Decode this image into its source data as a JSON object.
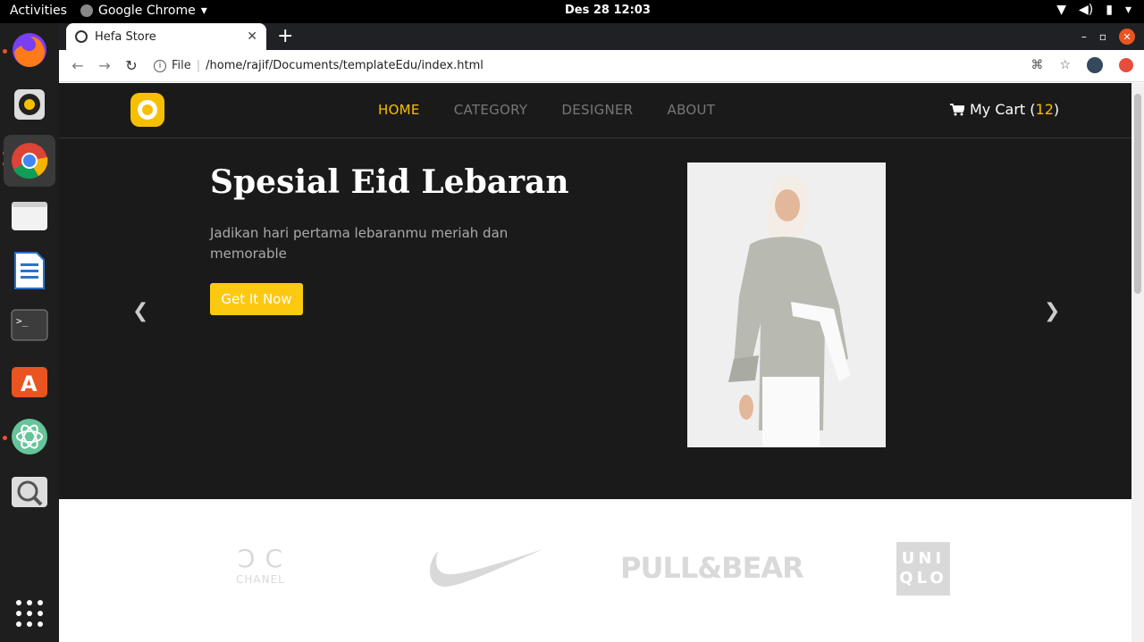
{
  "topbar": {
    "activities": "Activities",
    "app_name": "Google Chrome",
    "clock": "Des 28  12:03"
  },
  "dock": {
    "items": [
      "firefox-icon",
      "rhythmbox-icon",
      "chrome-icon",
      "files-icon",
      "writer-icon",
      "terminal-icon",
      "software-icon",
      "atom-icon",
      "screenshot-icon"
    ]
  },
  "browser": {
    "tab_title": "Hefa Store",
    "url_label": "File",
    "url": "/home/rajif/Documents/templateEdu/index.html"
  },
  "site": {
    "menu": [
      "HOME",
      "CATEGORY",
      "DESIGNER",
      "ABOUT"
    ],
    "cart_label": "My Cart (",
    "cart_count": "12",
    "cart_close": ")",
    "hero": {
      "title": "Spesial Eid Lebaran",
      "subtitle": "Jadikan hari pertama lebaranmu meriah dan memorable",
      "cta": "Get It Now"
    },
    "brands": {
      "chanel": "CHANEL",
      "pull": "PULL&BEAR",
      "uniqlo_top": "UNI",
      "uniqlo_bottom": "QLO"
    }
  },
  "colors": {
    "accent": "#f6c000",
    "page_bg": "#1b1a1b"
  }
}
